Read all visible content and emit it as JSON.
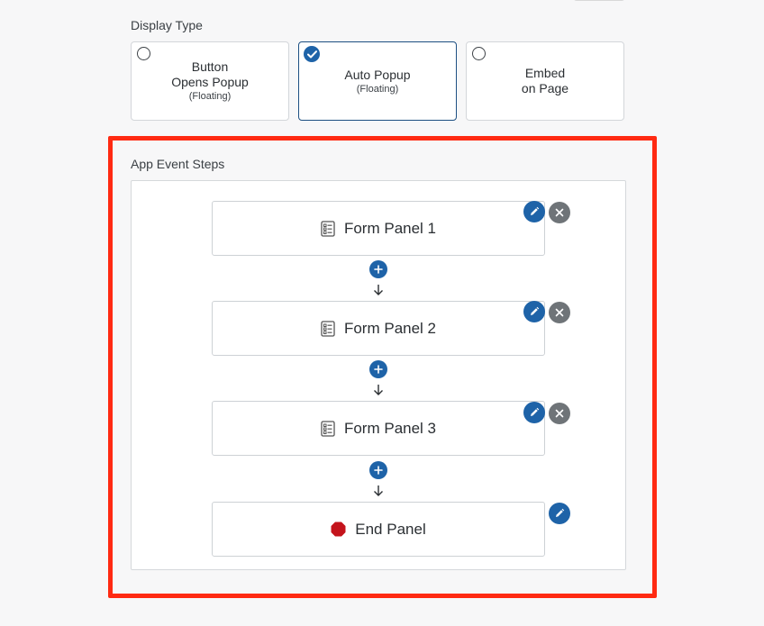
{
  "display_type": {
    "label": "Display Type",
    "options": [
      {
        "lines": [
          "Button",
          "Opens Popup"
        ],
        "sub": "(Floating)",
        "selected": false
      },
      {
        "lines": [
          "Auto Popup"
        ],
        "sub": "(Floating)",
        "selected": true
      },
      {
        "lines": [
          "Embed",
          "on Page"
        ],
        "sub": "",
        "selected": false
      }
    ]
  },
  "steps": {
    "label": "App Event Steps",
    "panels": [
      {
        "title": "Form Panel 1",
        "icon": "form-list-icon"
      },
      {
        "title": "Form Panel 2",
        "icon": "form-list-icon"
      },
      {
        "title": "Form Panel 3",
        "icon": "form-list-icon"
      },
      {
        "title": "End Panel",
        "icon": "stop-octagon-icon"
      }
    ]
  },
  "colors": {
    "accent": "#1e63a8",
    "delete": "#6f7478",
    "highlight": "#ff2a12",
    "stop": "#c4141c"
  }
}
